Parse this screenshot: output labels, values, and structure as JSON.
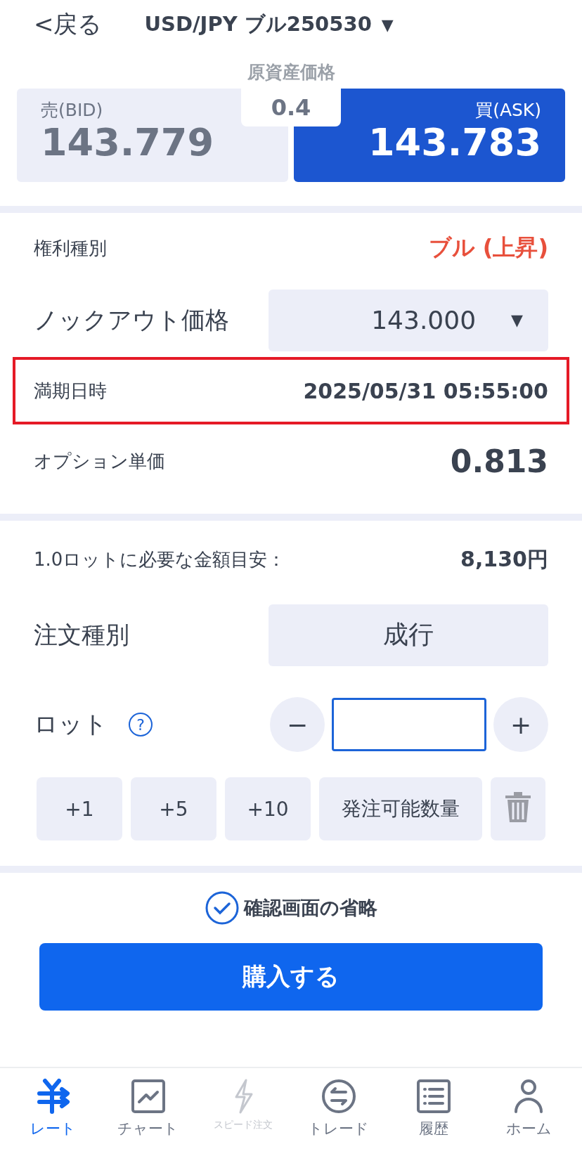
{
  "header": {
    "back": "<戻る",
    "title": "USD/JPY ブル250530",
    "dropdown": "▼"
  },
  "quote": {
    "label": "原資産価格",
    "spread": "0.4",
    "bid": {
      "label": "売(BID)",
      "price": "143.779"
    },
    "ask": {
      "label": "買(ASK)",
      "price": "143.783"
    }
  },
  "details": [
    {
      "kind": "text",
      "label": "権利種別",
      "value": "ブル (上昇)",
      "accent": true
    },
    {
      "kind": "select",
      "label": "ノックアウト価格",
      "value": "143.000",
      "caret": "▼"
    },
    {
      "kind": "text",
      "label": "満期日時",
      "value": "2025/05/31 05:55:00",
      "accent": false,
      "highlighted": true
    },
    {
      "kind": "big",
      "label": "オプション単価",
      "value": "0.813"
    }
  ],
  "order": {
    "required_label": "1.0ロットに必要な金額目安：",
    "required_value": "8,130円",
    "type_label": "注文種別",
    "type_value": "成行",
    "lot_label": "ロット",
    "help": "?",
    "minus": "−",
    "plus": "+",
    "quick": [
      "+1",
      "+5",
      "+10",
      "発注可能数量"
    ]
  },
  "skip_confirm": {
    "label": "確認画面の省略",
    "checked": true
  },
  "buy_button": "購入する",
  "nav": [
    {
      "kind": "yen",
      "label": "レート",
      "selected": true,
      "disabled": false
    },
    {
      "kind": "chart",
      "label": "チャート",
      "selected": false,
      "disabled": false
    },
    {
      "kind": "bolt",
      "label": "スピード注文",
      "selected": false,
      "disabled": true
    },
    {
      "kind": "swap",
      "label": "トレード",
      "selected": false,
      "disabled": false
    },
    {
      "kind": "list",
      "label": "履歴",
      "selected": false,
      "disabled": false
    },
    {
      "kind": "person",
      "label": "ホーム",
      "selected": false,
      "disabled": false
    }
  ]
}
